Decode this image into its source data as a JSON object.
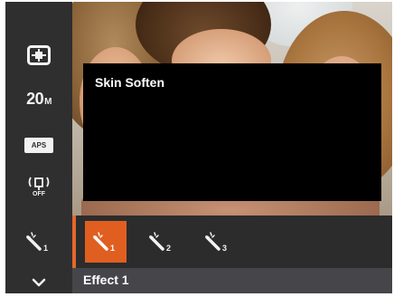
{
  "sidebar": {
    "items": [
      {
        "icon": "metering-icon"
      },
      {
        "label": "20",
        "suffix": "M",
        "icon": "resolution-icon"
      },
      {
        "label": "APS",
        "icon": "aps-icon"
      },
      {
        "label": "OFF",
        "icon": "stabilizer-off-icon"
      },
      {
        "subscript": "1",
        "icon": "skin-soften-icon"
      },
      {
        "icon": "chevron-down-icon"
      }
    ]
  },
  "popup": {
    "title": "Skin Soften"
  },
  "options": [
    {
      "subscript": "1",
      "icon": "skin-soften-1-icon",
      "selected": true
    },
    {
      "subscript": "2",
      "icon": "skin-soften-2-icon",
      "selected": false
    },
    {
      "subscript": "3",
      "icon": "skin-soften-3-icon",
      "selected": false
    }
  ],
  "status": {
    "label": "Effect 1"
  },
  "colors": {
    "accent": "#e05f20",
    "panel": "#2c2c2d",
    "sidebar": "#2f2f30",
    "status_bar": "#46464a"
  }
}
